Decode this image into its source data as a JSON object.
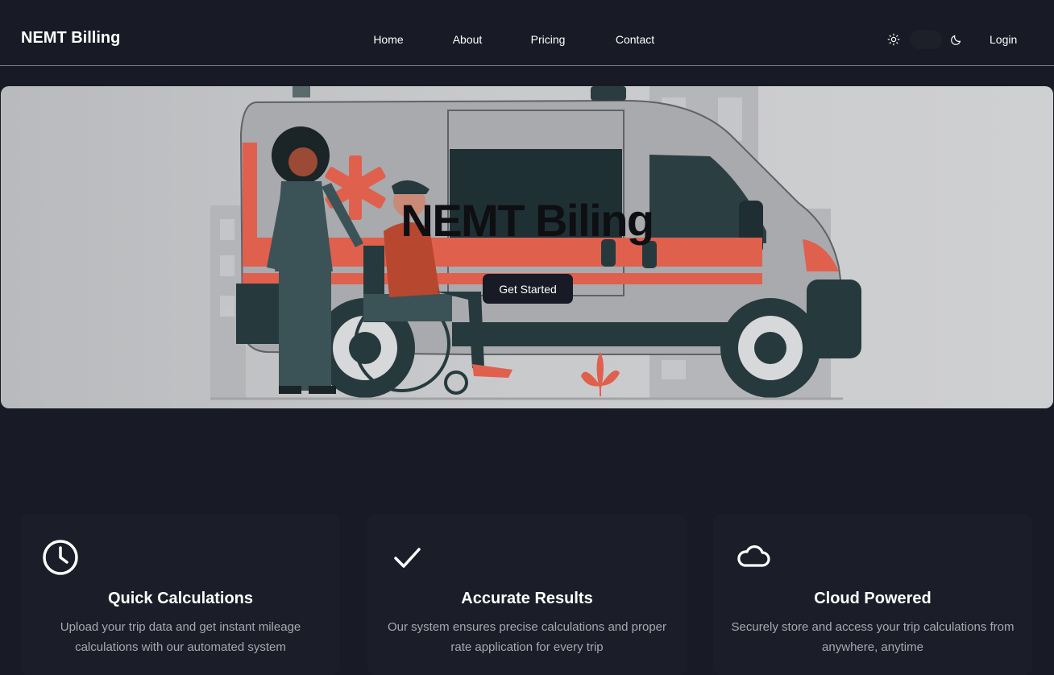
{
  "navbar": {
    "brand": "NEMT Billing",
    "links": [
      {
        "label": "Home"
      },
      {
        "label": "About"
      },
      {
        "label": "Pricing"
      },
      {
        "label": "Contact"
      }
    ],
    "login_label": "Login",
    "theme_icons": [
      "sun-icon",
      "moon-icon"
    ]
  },
  "hero": {
    "title": "NEMT Biling",
    "cta_label": "Get Started"
  },
  "features": [
    {
      "icon": "clock-icon",
      "title": "Quick Calculations",
      "description": "Upload your trip data and get instant mileage calculations with our automated system"
    },
    {
      "icon": "check-icon",
      "title": "Accurate Results",
      "description": "Our system ensures precise calculations and proper rate application for every trip"
    },
    {
      "icon": "cloud-icon",
      "title": "Cloud Powered",
      "description": "Securely store and access your trip calculations from anywhere, anytime"
    }
  ],
  "colors": {
    "background": "#181b25",
    "accent": "#e0604e",
    "dark_teal": "#263a3e"
  }
}
